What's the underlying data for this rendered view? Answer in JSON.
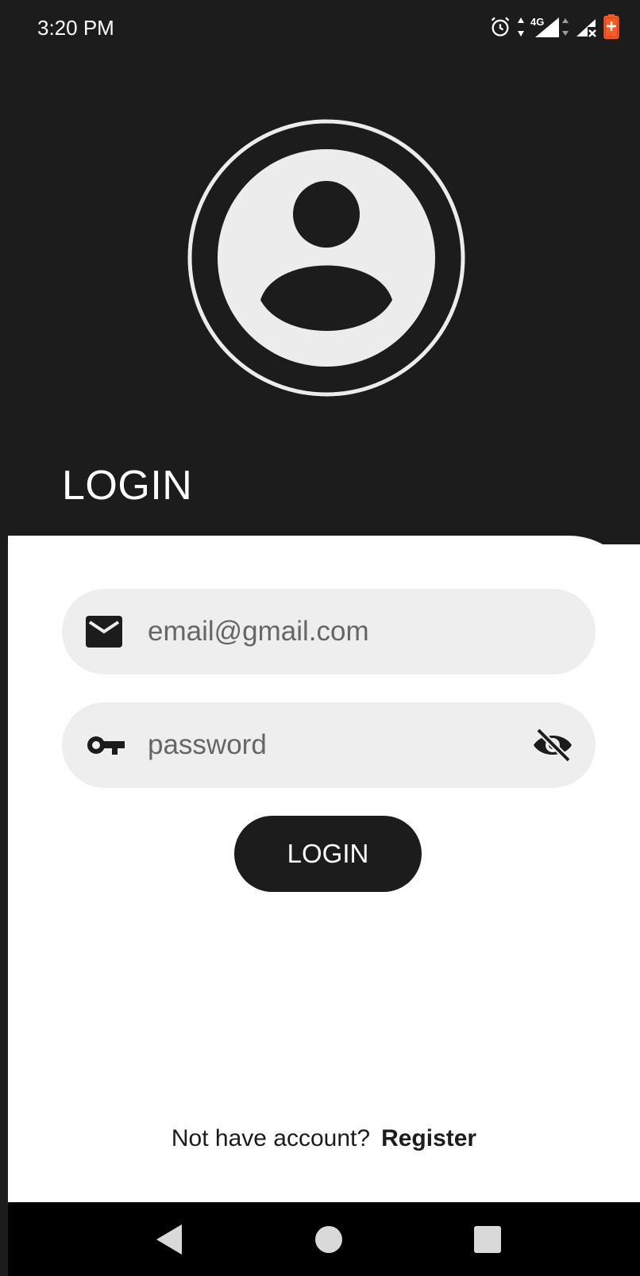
{
  "status_bar": {
    "time": "3:20 PM",
    "network": "4G",
    "icons": [
      "alarm-icon",
      "data-arrows-icon",
      "signal-4g-icon",
      "signal-no-service-icon",
      "battery-charging-icon"
    ],
    "battery_color": "#ff5722"
  },
  "header": {
    "title": "LOGIN",
    "avatar_icon": "account-circle-icon"
  },
  "form": {
    "email": {
      "icon": "mail-icon",
      "placeholder": "email@gmail.com",
      "value": ""
    },
    "password": {
      "icon": "key-icon",
      "placeholder": "password",
      "value": "",
      "toggle_icon": "visibility-off-icon"
    },
    "submit_label": "LOGIN"
  },
  "footer": {
    "prompt": "Not have account?",
    "register_label": "Register"
  },
  "nav": {
    "icons": [
      "back-icon",
      "home-icon",
      "recents-icon"
    ]
  },
  "colors": {
    "dark": "#1c1c1c",
    "field_bg": "#eeeeee",
    "white": "#ffffff"
  }
}
